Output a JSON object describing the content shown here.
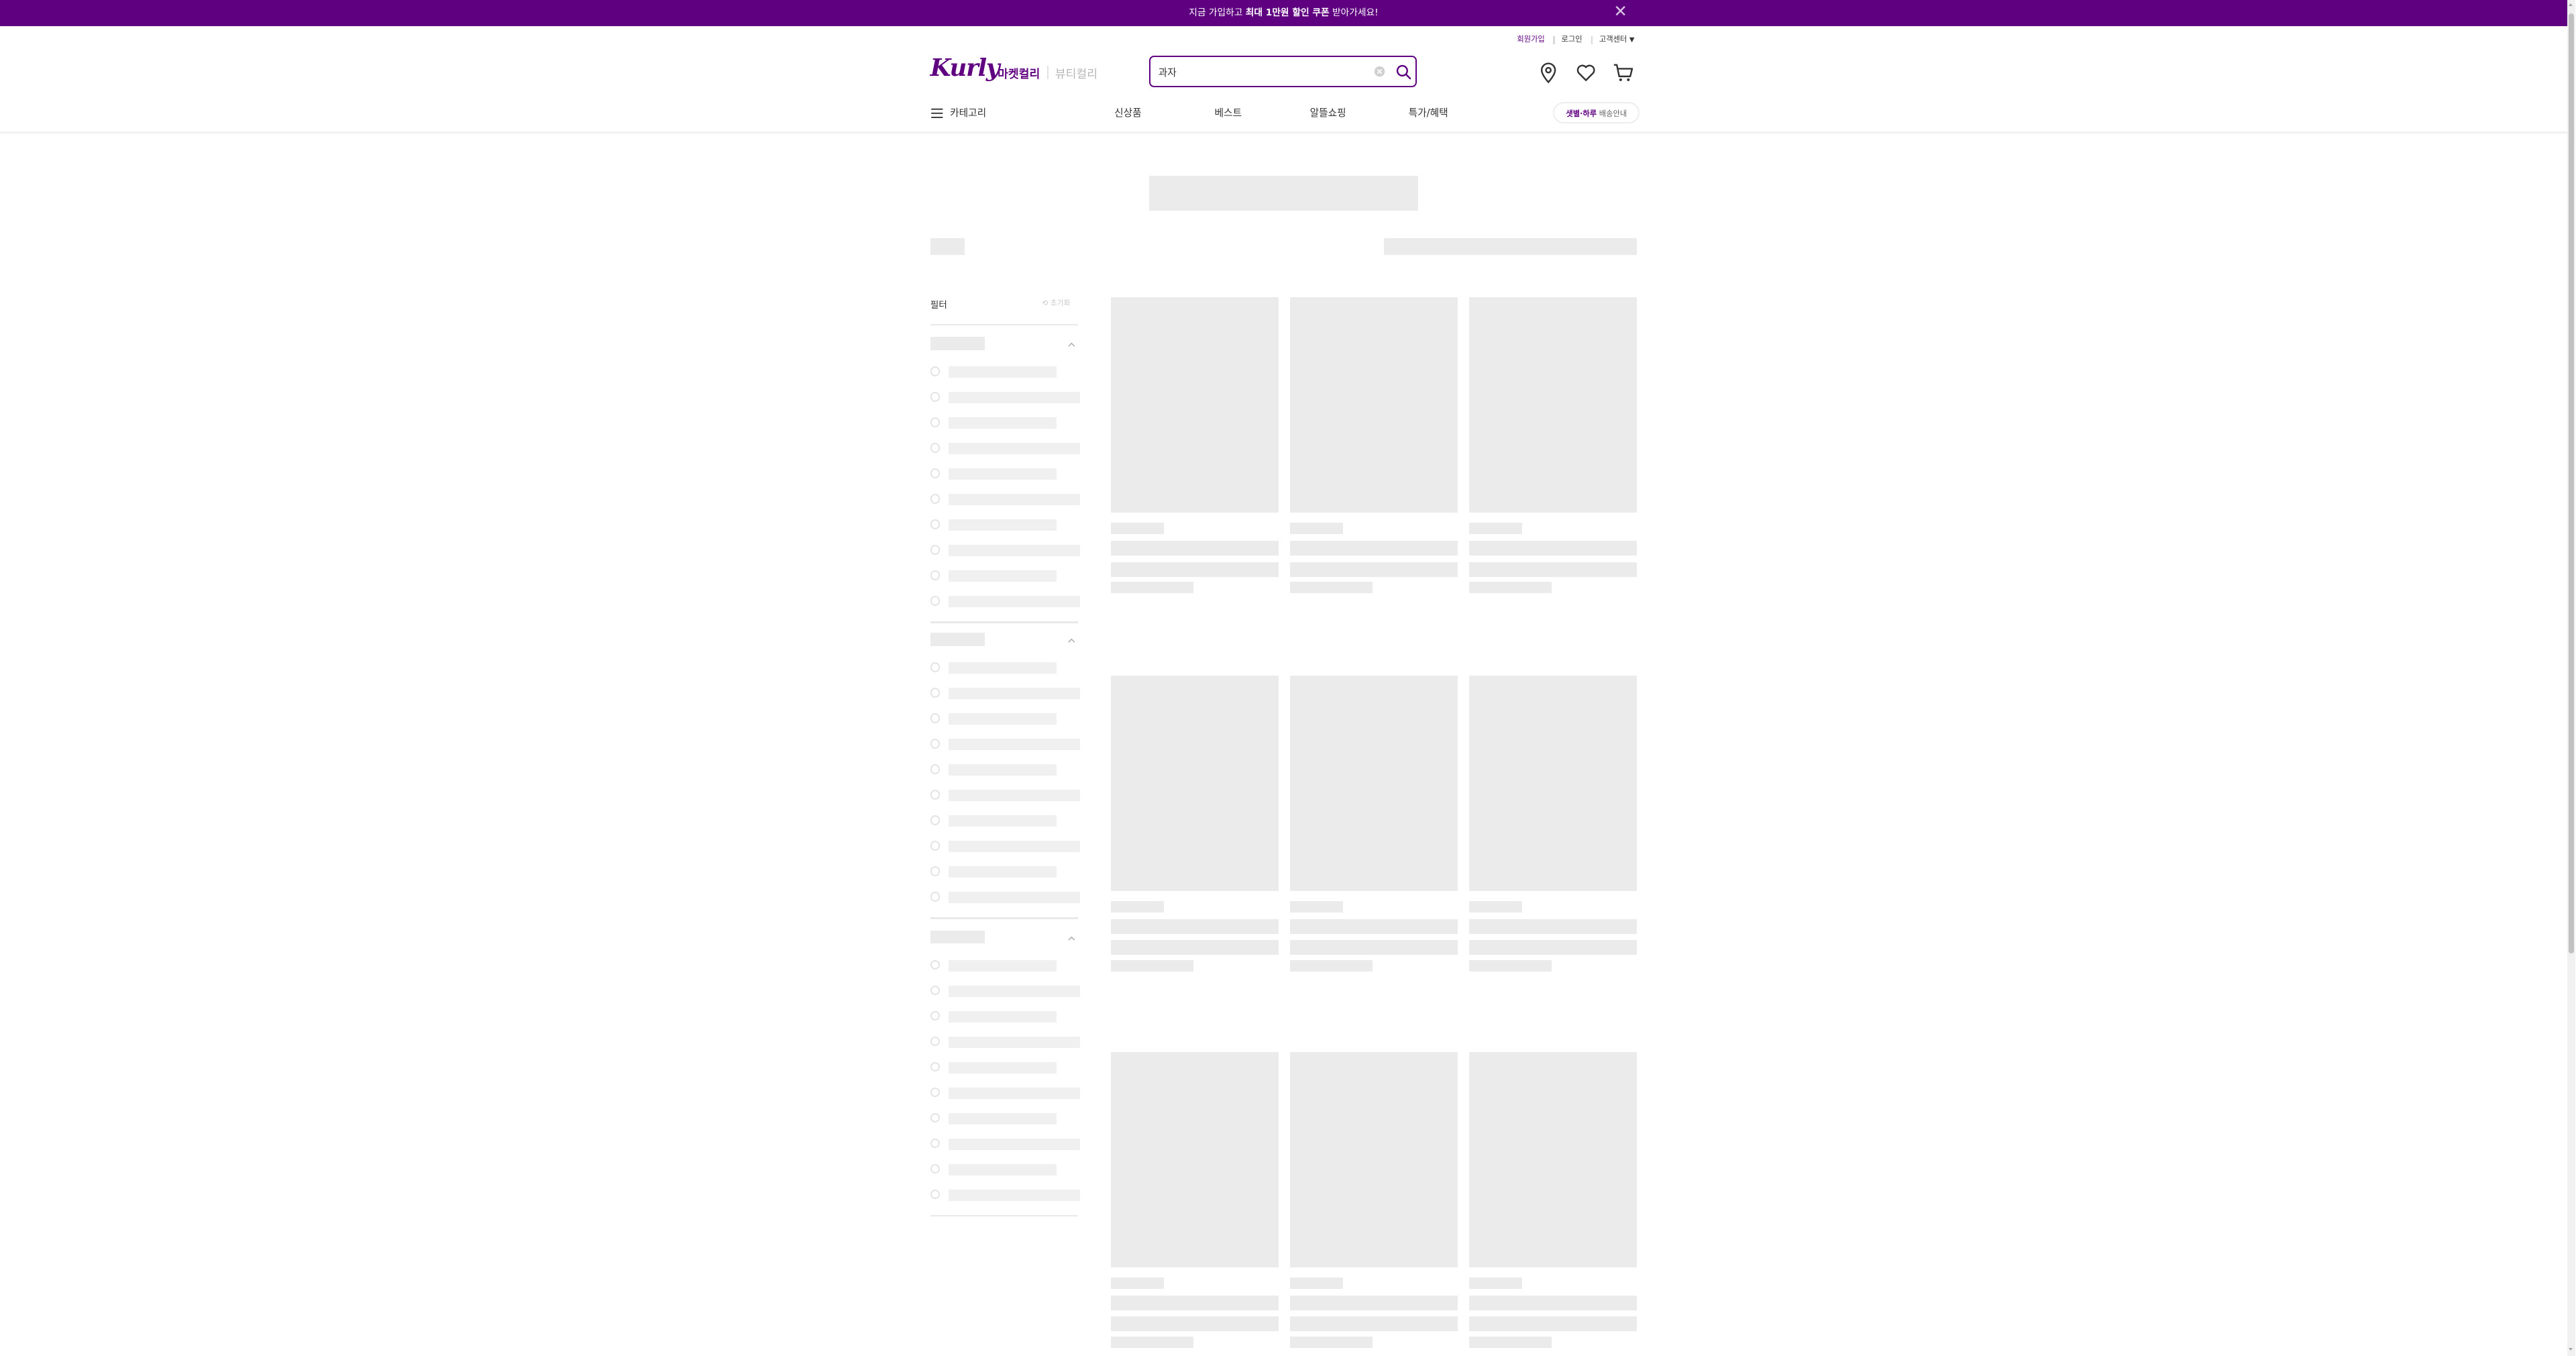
{
  "promo": {
    "text_before": "지금 가입하고 ",
    "text_bold": "최대 1만원 할인 쿠폰",
    "text_after": " 받아가세요!",
    "close_icon": "close-icon"
  },
  "utility": {
    "signup": "회원가입",
    "login": "로그인",
    "customer_center": "고객센터"
  },
  "header": {
    "logo": "Kurly",
    "tab_market": "마켓컬리",
    "tab_beauty": "뷰티컬리",
    "search_value": "과자",
    "icons": [
      "location-icon",
      "heart-icon",
      "cart-icon"
    ]
  },
  "nav": {
    "category": "카테고리",
    "items": [
      "신상품",
      "베스트",
      "알뜰쇼핑",
      "특가/혜택"
    ],
    "delivery_bold": "샛별·하루",
    "delivery_rest": " 배송안내"
  },
  "filter": {
    "title": "필터",
    "reset": "초기화"
  },
  "colors": {
    "brand": "#5f0080",
    "skeleton": "#ebebeb"
  }
}
